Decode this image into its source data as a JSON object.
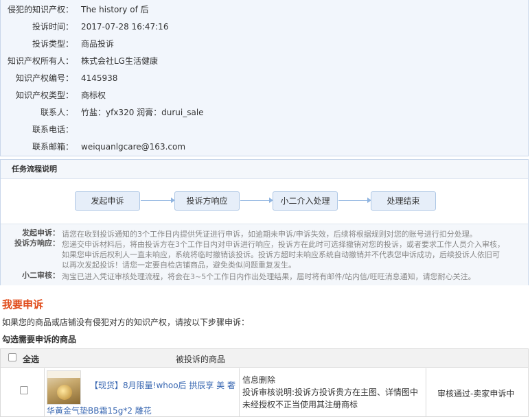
{
  "info": {
    "fields": [
      {
        "label": "侵犯的知识产权：",
        "value": "The history of 后"
      },
      {
        "label": "投诉时间：",
        "value": "2017-07-28 16:47:16"
      },
      {
        "label": "投诉类型：",
        "value": "商品投诉"
      },
      {
        "label": "知识产权所有人：",
        "value": "株式会社LG生活健康"
      },
      {
        "label": "知识产权编号：",
        "value": "4145938"
      },
      {
        "label": "知识产权类型：",
        "value": "商标权"
      },
      {
        "label": "联系人：",
        "value": "竹盐：yfx320 润膏：durui_sale"
      },
      {
        "label": "联系电话：",
        "value": ""
      },
      {
        "label": "联系邮箱：",
        "value": "weiquanlgcare@163.com"
      }
    ]
  },
  "flow": {
    "title": "任务流程说明",
    "steps": [
      "发起申诉",
      "投诉方响应",
      "小二介入处理",
      "处理结束"
    ],
    "descriptions": [
      {
        "label": "发起申诉：",
        "lines": [
          "请您在收到投诉通知的3个工作日内提供凭证进行申诉，如逾期未申诉/申诉失效，后续将根据规则对您的账号进行扣分处理。"
        ]
      },
      {
        "label": "投诉方响应：",
        "lines": [
          "您递交申诉材料后，将由投诉方在3个工作日内对申诉进行响应，投诉方在此时可选择撤销对您的投诉，或者要求工作人员介入审核，",
          "如果您申诉后权利人一直未响应，系统将临时撤销该投诉。投诉方超时未响应系统自动撤销并不代表您申诉成功，后续投诉人依旧可",
          "以再次发起投诉！请您一定要自检店铺商品，避免类似问题重复发生。"
        ]
      },
      {
        "label": "小二审核：",
        "lines": [
          "淘宝已进入凭证审核处理流程，将会在3~5个工作日内作出处理结果，届时将有邮件/站内信/旺旺消息通知，请您耐心关注。"
        ]
      }
    ]
  },
  "appeal": {
    "title": "我要申诉",
    "description": "如果您的商品或店铺没有侵犯对方的知识产权，请按以下步骤申诉：",
    "select_title": "勾选需要申诉的商品"
  },
  "table": {
    "select_all_label": "全选",
    "goods_header": "被投诉的商品",
    "rows": [
      {
        "name_line1": "【现货】8月限量!whoo后 拱辰享 美 奢",
        "name_line2": "华黄金气垫BB霜15g*2 雕花",
        "reason_line1": "信息删除",
        "reason_line2": "投诉审核说明:投诉方投诉贵方在主图、详情图中",
        "reason_line3": "未经授权不正当使用其注册商标",
        "status": "审核通过-卖家申诉中",
        "checked": false
      }
    ]
  },
  "colors": {
    "accent_orange": "#e04b1a",
    "link_blue": "#3a68b2",
    "panel_bg": "#f2f6fc",
    "step_bg": "#e6eef9"
  }
}
